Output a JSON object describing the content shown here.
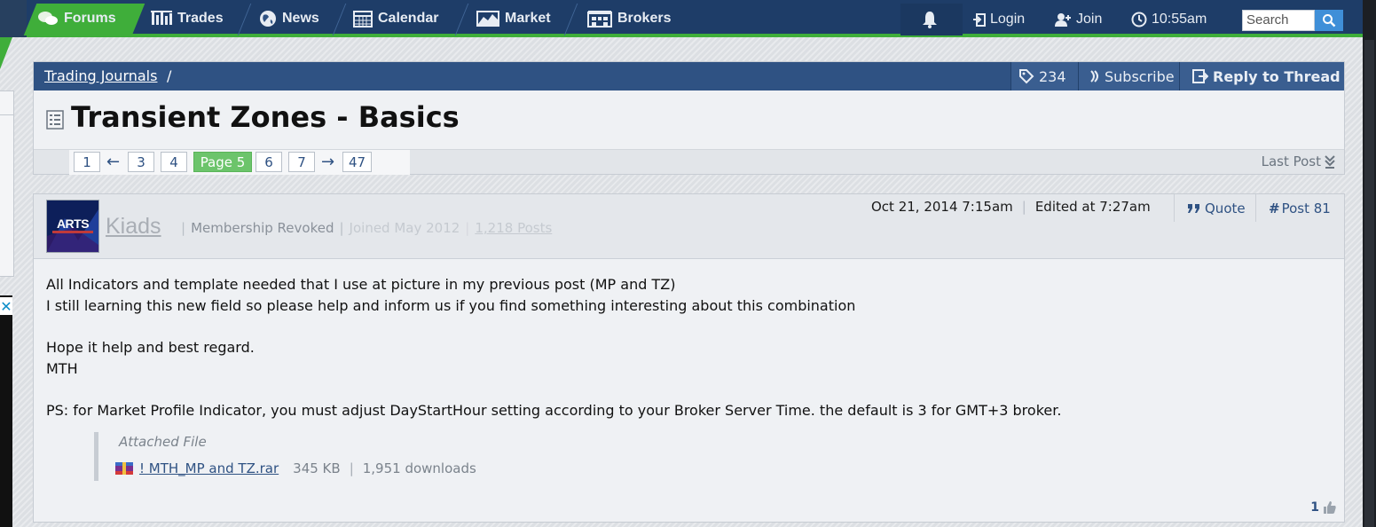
{
  "nav": {
    "items": [
      {
        "label": "Forums",
        "icon": "chat-bubbles-icon",
        "active": true
      },
      {
        "label": "Trades",
        "icon": "bars-chart-icon"
      },
      {
        "label": "News",
        "icon": "globe-icon"
      },
      {
        "label": "Calendar",
        "icon": "calendar-icon"
      },
      {
        "label": "Market",
        "icon": "line-chart-icon"
      },
      {
        "label": "Brokers",
        "icon": "buildings-icon"
      }
    ],
    "login_label": "Login",
    "join_label": "Join",
    "time": "10:55am",
    "search_placeholder": "Search",
    "colors": {
      "bar": "#1e3d68",
      "tab": "#2f5283",
      "active": "#3fae3a"
    }
  },
  "thread": {
    "breadcrumb": "Trading Journals",
    "breadcrumb_sep": "/",
    "tags_count": "234",
    "subscribe_label": "Subscribe",
    "reply_label": "Reply to Thread",
    "title": "Transient Zones - Basics",
    "pages": {
      "first": "1",
      "prev_arrow": "←",
      "p3": "3",
      "p4": "4",
      "current": "Page 5",
      "p6": "6",
      "p7": "7",
      "next_arrow": "→",
      "last": "47"
    },
    "last_post_label": "Last Post"
  },
  "post": {
    "avatar_text": "ARTS",
    "username": "Kiads",
    "status": "Membership Revoked",
    "joined": "Joined May 2012",
    "posts": "1,218 Posts",
    "date": "Oct 21, 2014 7:15am",
    "edited": "Edited at 7:27am",
    "quote_label": "Quote",
    "post_number": "Post 81",
    "body": {
      "line1": "All Indicators and template needed that I use at picture in my previous post (MP and TZ)",
      "line2": "I still learning this new field so please help and inform us if you find something interesting about this combination",
      "line3": "Hope it help and best regard.",
      "line4": "MTH",
      "line5": "PS: for Market Profile Indicator, you must adjust DayStartHour setting according to your Broker Server Time. the default is 3 for GMT+3 broker."
    },
    "attachment": {
      "title": "Attached File",
      "file_name": "! MTH_MP and TZ.rar",
      "size": "345 KB",
      "downloads": "1,951 downloads"
    },
    "likes": "1"
  }
}
